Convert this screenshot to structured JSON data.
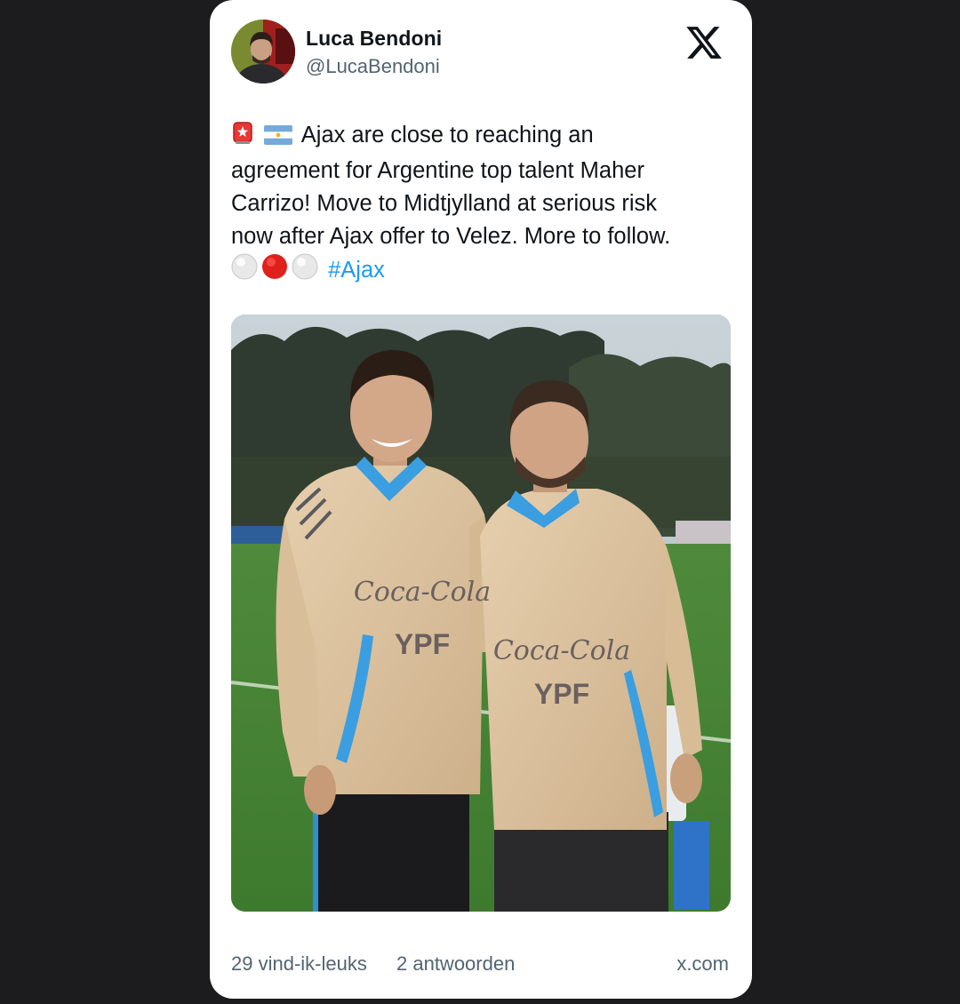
{
  "tweet": {
    "author_name": "Luca Bendoni",
    "author_handle": "@LucaBendoni",
    "text_line1": "Ajax are close to reaching an",
    "text_line2": "agreement for Argentine top talent Maher",
    "text_line3": "Carrizo! Move to Midtjylland at serious risk",
    "text_line4": "now after Ajax offer to Velez. More to follow.",
    "hashtag": "#Ajax",
    "leading_emojis": [
      "siren-emoji",
      "argentina-flag-emoji"
    ],
    "trailing_emojis": [
      "white-circle-emoji",
      "red-circle-emoji",
      "white-circle-emoji"
    ]
  },
  "media": {
    "shirt_sponsor_1": "Coca-Cola",
    "shirt_sponsor_2": "YPF"
  },
  "footer": {
    "likes": "29 vind-ik-leuks",
    "replies": "2 antwoorden",
    "domain": "x.com"
  },
  "colors": {
    "background": "#1c1c1e",
    "card": "#ffffff",
    "text_primary": "#0f1419",
    "text_secondary": "#536471",
    "hashtag": "#1d9bf0"
  },
  "icons": {
    "platform_logo": "x-logo-icon"
  }
}
